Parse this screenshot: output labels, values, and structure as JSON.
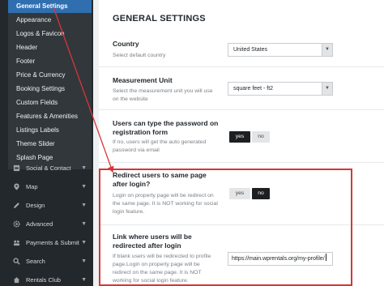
{
  "sidebar": {
    "sub_items": [
      {
        "label": "General Settings",
        "active": true
      },
      {
        "label": "Appearance"
      },
      {
        "label": "Logos & Favicon"
      },
      {
        "label": "Header"
      },
      {
        "label": "Footer"
      },
      {
        "label": "Price & Currency"
      },
      {
        "label": "Booking Settings"
      },
      {
        "label": "Custom Fields"
      },
      {
        "label": "Features & Amenities"
      },
      {
        "label": "Listings Labels"
      },
      {
        "label": "Theme Slider"
      },
      {
        "label": "Splash Page"
      }
    ],
    "main_items": [
      {
        "label": "Social & Contact",
        "icon": "share-icon"
      },
      {
        "label": "Map",
        "icon": "map-pin-icon"
      },
      {
        "label": "Design",
        "icon": "pencil-icon"
      },
      {
        "label": "Advanced",
        "icon": "gear-icon"
      },
      {
        "label": "Payments & Submit",
        "icon": "group-icon"
      },
      {
        "label": "Search",
        "icon": "search-icon"
      },
      {
        "label": "Rentals Club",
        "icon": "house-icon"
      }
    ]
  },
  "main": {
    "title": "GENERAL SETTINGS",
    "country": {
      "label": "Country",
      "desc": "Select default country",
      "value": "United States"
    },
    "measurement": {
      "label": "Measurement Unit",
      "desc": "Select the measurement unit you will use on the website",
      "value": "square feet - ft2"
    },
    "password": {
      "label": "Users can type the password on registration form",
      "desc": "If no, users will get the auto generated password via email",
      "yes": "yes",
      "no": "no"
    },
    "redirect": {
      "label": "Redirect users to same page after login?",
      "desc": "Login on property page will be redirect on the same page. It is NOT working for social login feature.",
      "yes": "yes",
      "no": "no"
    },
    "redirect_link": {
      "label": "Link where users will be redirected after login",
      "desc": "If blank users will be redirected to profile page.Login on property page will be redirect on the same page. It is NOT working for social login feature.",
      "value": "https://main.wprentals.org/my-profile/"
    }
  },
  "colors": {
    "accent": "#2f6fb0",
    "highlight": "#d63638",
    "sidebar": "#23282d"
  }
}
